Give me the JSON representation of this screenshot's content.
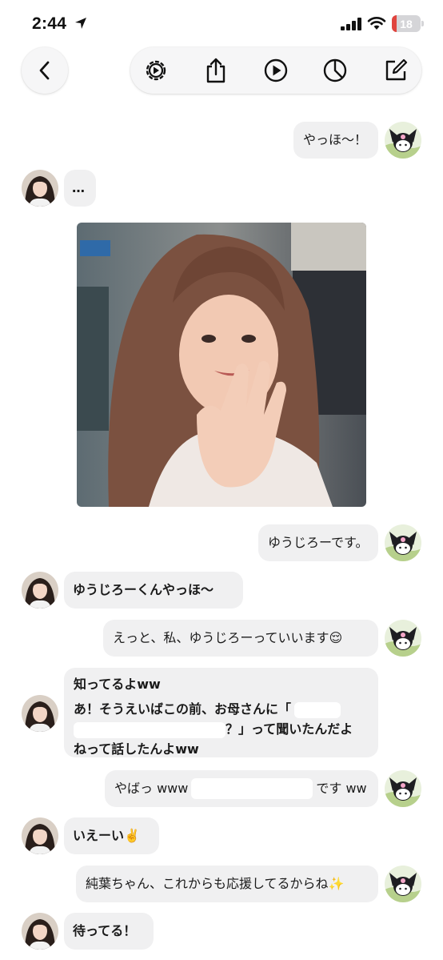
{
  "status_bar": {
    "time": "2:44",
    "battery_level": "18",
    "battery_fraction": 0.18,
    "battery_color": "#e0443e"
  },
  "toolbar": {
    "back_icon": "chevron-left-icon",
    "buttons": [
      {
        "icon": "gear-icon"
      },
      {
        "icon": "share-icon"
      },
      {
        "icon": "play-icon"
      },
      {
        "icon": "pie-chart-icon"
      },
      {
        "icon": "compose-icon"
      }
    ]
  },
  "messages": [
    {
      "side": "right",
      "text": "やっほ〜！"
    },
    {
      "side": "left",
      "text": "…"
    },
    {
      "side": "left",
      "type": "image"
    },
    {
      "side": "right",
      "text": "ゆうじろーです。"
    },
    {
      "side": "left",
      "text": "ゆうじろーくんやっほ〜"
    },
    {
      "side": "right",
      "text": "えっと、私、ゆうじろーっていいます😌"
    },
    {
      "side": "left",
      "lines": [
        "知ってるよww",
        "あ！そうえいばこの前、お母さんに「",
        "？」って聞いたんだよ",
        "ねって話したんよww"
      ]
    },
    {
      "side": "right",
      "text_start": "やばっ www",
      "text_end": "です ww"
    },
    {
      "side": "left",
      "text": "いえーい✌️"
    },
    {
      "side": "right",
      "text": "純葉ちゃん、これからも応援してるからね✨"
    },
    {
      "side": "left",
      "text": "待ってる！"
    }
  ]
}
